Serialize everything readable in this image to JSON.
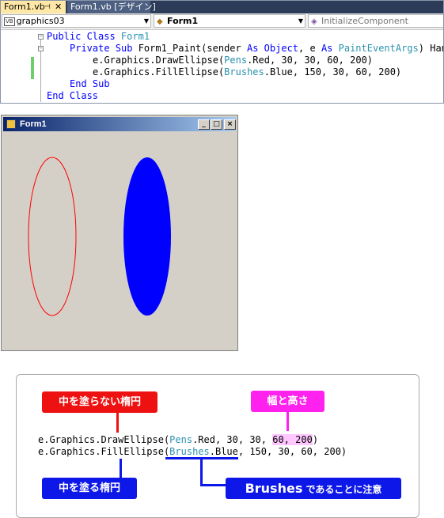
{
  "ide": {
    "tabs": [
      {
        "label": "Form1.vb",
        "active": true,
        "pin": "⊣",
        "close": "✕"
      },
      {
        "label": "Form1.vb [デザイン]",
        "active": false
      }
    ],
    "class_combo": {
      "badge": "VB",
      "value": "graphics03"
    },
    "object_combo": {
      "value": "Form1"
    },
    "method_combo": {
      "value": "InitializeComponent"
    },
    "code": {
      "line1": {
        "kw1": "Public Class",
        "name": " Form1"
      },
      "line2": {
        "kw1": "Private Sub",
        "p1": " Form1_Paint(sender ",
        "kw2": "As",
        "sp": " ",
        "ty1": "Object",
        "p2": ", e ",
        "kw3": "As",
        "sp2": " ",
        "ty2": "PaintEventArgs",
        "p3": ") Handl"
      },
      "line3": {
        "p1": "e.Graphics.DrawEllipse(",
        "ty": "Pens",
        "p2": ".Red, 30, 30, 60, 200)"
      },
      "line4": {
        "p1": "e.Graphics.FillEllipse(",
        "ty": "Brushes",
        "p2": ".Blue, 150, 30, 60, 200)"
      },
      "line5": {
        "kw": "End Sub"
      },
      "line6": {
        "kw": "End Class"
      }
    }
  },
  "form": {
    "title": "Form1",
    "minimize": "_",
    "maximize": "□",
    "close": "×",
    "colors": {
      "background": "#d4d0c8",
      "red_outline": "#ff0000",
      "blue_fill": "#0000ff"
    }
  },
  "annotation": {
    "labels": {
      "draw": "中を塗らない楕円",
      "size": "幅と高さ",
      "fill": "中を塗る楕円",
      "brush_big": "Brushes",
      "brush_small": " であることに注意"
    },
    "code_line1": {
      "p1": "e.Graphics.DrawEllipse(",
      "ty": "Pens",
      "p2": ".Red, 30, 30, ",
      "hl": "60, 200",
      "p3": ")"
    },
    "code_line2": {
      "p1": "e.Graphics.FillEllipse(",
      "ty": "Brushes",
      "p2": ".Blue, 150, 30, 60, 200)"
    },
    "colors": {
      "red": "#ee1111",
      "magenta": "#ff22ee",
      "blue": "#0d17e8",
      "highlight": "#ffc6ff"
    }
  }
}
